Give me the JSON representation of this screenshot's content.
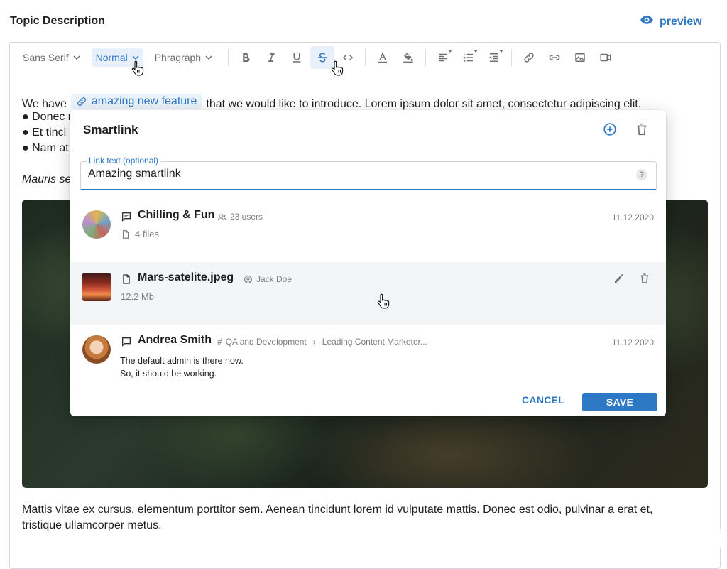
{
  "header": {
    "title": "Topic Description",
    "preview_label": "preview"
  },
  "toolbar": {
    "font_family": "Sans Serif",
    "font_size": "Normal",
    "block_format": "Phragraph",
    "icons": [
      "bold-icon",
      "italic-icon",
      "underline-icon",
      "strikethrough-icon",
      "code-icon",
      "text-color-icon",
      "highlight-icon",
      "align-icon",
      "list-icon",
      "indent-icon",
      "link-icon",
      "smartlink-icon",
      "image-icon",
      "video-icon"
    ]
  },
  "content": {
    "line1_before": "We have",
    "inline_link": "amazing new feature",
    "line1_after": "that we would like to introduce. Lorem ipsum dolor sit amet, consectetur adipiscing elit.",
    "bullets": [
      "● Donec r",
      "● Et tinci",
      "● Nam at"
    ],
    "italic_line": "Mauris se",
    "bottom_link": "Mattis vitae ex cursus, elementum porttitor sem.",
    "bottom_text": " Aenean tincidunt lorem id vulputate mattis. Donec est odio, pulvinar a erat et,",
    "bottom_text2": "tristique ullamcorper metus."
  },
  "smartlink": {
    "title": "Smartlink",
    "field_label": "Link text (optional)",
    "field_value": "Amazing smartlink",
    "help": "?",
    "items": [
      {
        "name": "Chilling & Fun",
        "meta": "23 users",
        "sub": "4 files",
        "date": "11.12.2020"
      },
      {
        "name": "Mars-satelite.jpeg",
        "meta": "Jack Doe",
        "sub": "12.2 Mb"
      },
      {
        "name": "Andrea Smith",
        "channel": "QA and Development",
        "path": "Leading Content Marketer...",
        "date": "11.12.2020",
        "message_line1": "The default admin is there now.",
        "message_line2": "So, it should be working."
      }
    ],
    "cancel_label": "CANCEL",
    "save_label": "SAVE"
  },
  "colors": {
    "accent": "#2f78c4",
    "accent_bg": "#e8f1fb",
    "muted": "#6d6f73"
  }
}
